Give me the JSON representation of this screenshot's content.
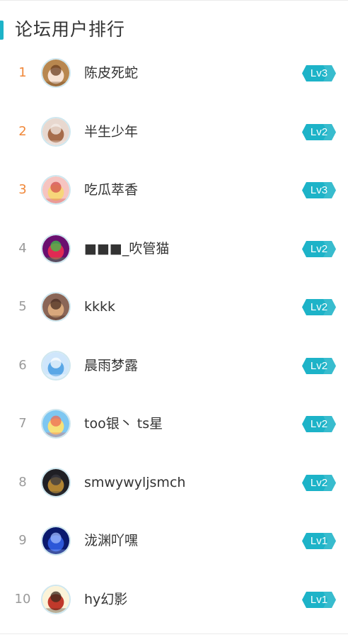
{
  "header": {
    "title": "论坛用户排行"
  },
  "colors": {
    "accent": "#1db3c8",
    "rank_top": "#f0883a",
    "rank_normal": "#9a9a9a",
    "badge": "#1db3c8"
  },
  "users": [
    {
      "rank": "1",
      "name": "陈皮死蛇",
      "level": "Lv3",
      "avatar_icon": "anime-girl-brown-avatar",
      "avatar_colors": [
        "#b8874f",
        "#f7e3d5",
        "#6b3e1f"
      ]
    },
    {
      "rank": "2",
      "name": "半生少年",
      "level": "Lv2",
      "avatar_icon": "anime-girl-cream-avatar",
      "avatar_colors": [
        "#e8d8cf",
        "#a66c4a",
        "#f4ece7"
      ]
    },
    {
      "rank": "3",
      "name": "吃瓜萃香",
      "level": "Lv3",
      "avatar_icon": "anime-girl-blonde-avatar",
      "avatar_colors": [
        "#f6c4c0",
        "#f7d67a",
        "#d4504e"
      ]
    },
    {
      "rank": "4",
      "name": "■■■_吹管猫",
      "level": "Lv2",
      "avatar_icon": "glitch-art-avatar",
      "avatar_colors": [
        "#6a0f6f",
        "#e12a53",
        "#3cc54a"
      ]
    },
    {
      "rank": "5",
      "name": "kkkk",
      "level": "Lv2",
      "avatar_icon": "cartoon-bear-avatar",
      "avatar_colors": [
        "#8a6657",
        "#d8a87c",
        "#4a2e22"
      ]
    },
    {
      "rank": "6",
      "name": "晨雨梦露",
      "level": "Lv2",
      "avatar_icon": "anime-girl-blue-avatar",
      "avatar_colors": [
        "#cfe6fb",
        "#5aa7e6",
        "#ffffff"
      ]
    },
    {
      "rank": "7",
      "name": "too银丶 ts星",
      "level": "Lv2",
      "avatar_icon": "anime-girl-sky-avatar",
      "avatar_colors": [
        "#7ec7f1",
        "#f7e178",
        "#ee6b55"
      ]
    },
    {
      "rank": "8",
      "name": "smwywyljsmch",
      "level": "Lv2",
      "avatar_icon": "night-building-avatar",
      "avatar_colors": [
        "#1f1f24",
        "#b08433",
        "#3a3a40"
      ]
    },
    {
      "rank": "9",
      "name": "泷渊吖嘿",
      "level": "Lv1",
      "avatar_icon": "blue-night-avatar",
      "avatar_colors": [
        "#0a1a6e",
        "#2c57d8",
        "#9fb9ff"
      ]
    },
    {
      "rank": "10",
      "name": "hy幻影",
      "level": "Lv1",
      "avatar_icon": "cartoon-couple-avatar",
      "avatar_colors": [
        "#fbf3d8",
        "#c0392b",
        "#3b2a1e"
      ]
    }
  ]
}
